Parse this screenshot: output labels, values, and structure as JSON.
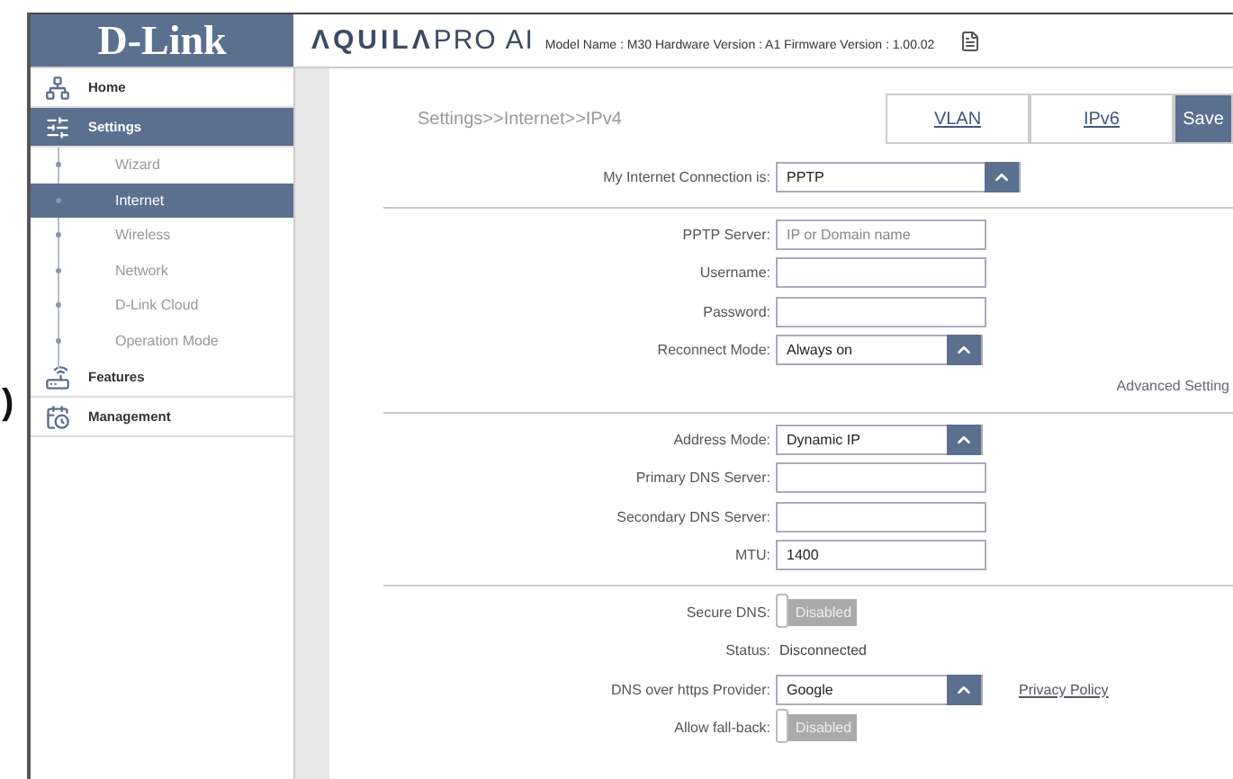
{
  "edge_fragment": ")",
  "header": {
    "logo": "D-Link",
    "brand_strong": "ΛQUILΛ",
    "brand_light": "PRO AI",
    "model_info": "Model Name : M30 Hardware Version : A1 Firmware Version : 1.00.02"
  },
  "sidebar": {
    "items": [
      {
        "label": "Home",
        "selected": false
      },
      {
        "label": "Settings",
        "selected": true,
        "children": [
          {
            "label": "Wizard",
            "selected": false
          },
          {
            "label": "Internet",
            "selected": true
          },
          {
            "label": "Wireless",
            "selected": false
          },
          {
            "label": "Network",
            "selected": false
          },
          {
            "label": "D-Link Cloud",
            "selected": false
          },
          {
            "label": "Operation Mode",
            "selected": false
          }
        ]
      },
      {
        "label": "Features",
        "selected": false
      },
      {
        "label": "Management",
        "selected": false
      }
    ]
  },
  "breadcrumb": "Settings>>Internet>>IPv4",
  "tabs": [
    {
      "label": "VLAN",
      "kind": "link"
    },
    {
      "label": "IPv6",
      "kind": "link"
    },
    {
      "label": "Save",
      "kind": "button"
    }
  ],
  "groups": [
    {
      "rows": [
        {
          "kind": "select",
          "wide": true,
          "label": "My Internet Connection is:",
          "value": "PPTP"
        }
      ]
    },
    {
      "rows": [
        {
          "kind": "input",
          "label": "PPTP Server:",
          "placeholder": "IP or Domain name"
        },
        {
          "kind": "input",
          "label": "Username:"
        },
        {
          "kind": "input",
          "label": "Password:"
        },
        {
          "kind": "select",
          "label": "Reconnect Mode:",
          "value": "Always on"
        }
      ],
      "link": "Advanced Setting"
    },
    {
      "rows": [
        {
          "kind": "select",
          "label": "Address Mode:",
          "value": "Dynamic IP"
        },
        {
          "kind": "input",
          "label": "Primary DNS Server:"
        },
        {
          "kind": "input",
          "label": "Secondary DNS Server:"
        },
        {
          "kind": "input",
          "label": "MTU:",
          "value": "1400"
        }
      ]
    },
    {
      "rows": [
        {
          "kind": "toggle",
          "label": "Secure DNS:",
          "on": false,
          "state_text": "Disabled"
        },
        {
          "kind": "text",
          "label": "Status:",
          "value": "Disconnected"
        },
        {
          "kind": "select",
          "label": "DNS over https Provider:",
          "value": "Google",
          "link": "Privacy Policy"
        },
        {
          "kind": "toggle",
          "label": "Allow fall-back:",
          "on": false,
          "state_text": "Disabled"
        }
      ]
    }
  ]
}
